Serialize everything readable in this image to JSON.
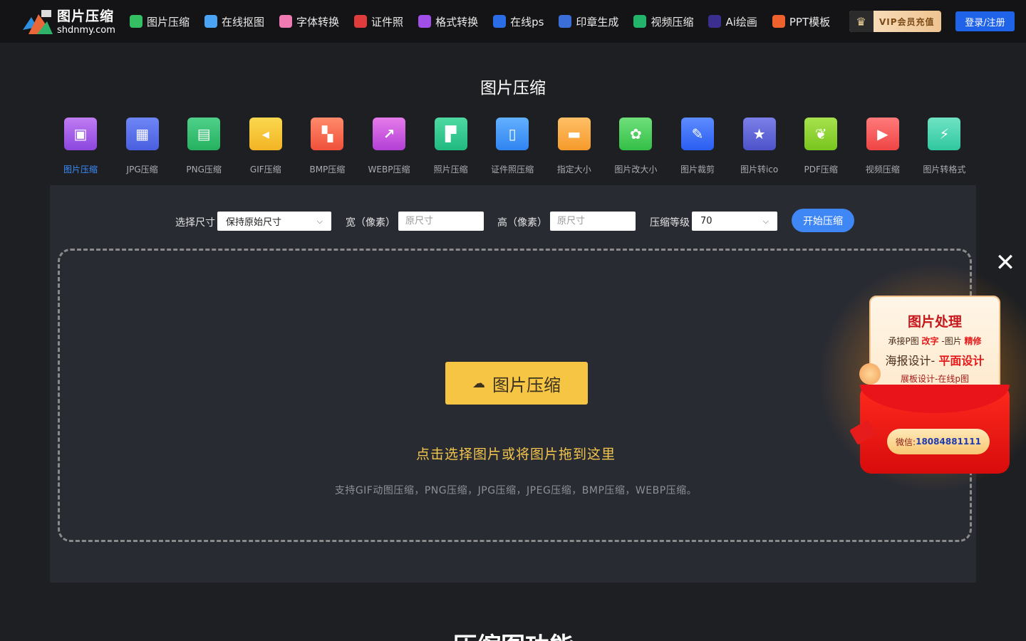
{
  "header": {
    "logo_title": "图片压缩",
    "logo_url": "shdnmy.com",
    "nav": [
      {
        "label": "图片压缩",
        "icon": "image-icon",
        "color": "#34c062"
      },
      {
        "label": "在线抠图",
        "icon": "cutout-icon",
        "color": "#4aa3f5"
      },
      {
        "label": "字体转换",
        "icon": "font-icon",
        "color": "#f07ab2"
      },
      {
        "label": "证件照",
        "icon": "id-photo-icon",
        "color": "#e03c3c"
      },
      {
        "label": "格式转换",
        "icon": "format-icon",
        "color": "#a24ee8"
      },
      {
        "label": "在线ps",
        "icon": "ps-icon",
        "color": "#2b6de6"
      },
      {
        "label": "印章生成",
        "icon": "stamp-icon",
        "color": "#3b6ed8"
      },
      {
        "label": "视频压缩",
        "icon": "video-icon",
        "color": "#21b46a"
      },
      {
        "label": "Ai绘画",
        "icon": "ai-icon",
        "color": "#3a2f8f"
      },
      {
        "label": "PPT模板",
        "icon": "ppt-icon",
        "color": "#f0622d"
      }
    ],
    "vip_label": "VIP会员充值",
    "login_label": "登录/注册"
  },
  "page_title": "图片压缩",
  "tools": [
    {
      "label": "图片压缩",
      "icon": "image-compress-icon",
      "gradient": [
        "#c07cf2",
        "#8b46df"
      ],
      "glyph": "▣",
      "active": true
    },
    {
      "label": "JPG压缩",
      "icon": "jpg-compress-icon",
      "gradient": [
        "#6e86f5",
        "#4a5fe0"
      ],
      "glyph": "▦",
      "active": false
    },
    {
      "label": "PNG压缩",
      "icon": "png-compress-icon",
      "gradient": [
        "#4fd08a",
        "#25b15f"
      ],
      "glyph": "▤",
      "active": false
    },
    {
      "label": "GIF压缩",
      "icon": "gif-compress-icon",
      "gradient": [
        "#fbd84e",
        "#f2b424"
      ],
      "glyph": "◂",
      "active": false
    },
    {
      "label": "BMP压缩",
      "icon": "bmp-compress-icon",
      "gradient": [
        "#ff8a6b",
        "#f0503a"
      ],
      "glyph": "▚",
      "active": false
    },
    {
      "label": "WEBP压缩",
      "icon": "webp-compress-icon",
      "gradient": [
        "#e57bea",
        "#b33fd6"
      ],
      "glyph": "↗",
      "active": false
    },
    {
      "label": "照片压缩",
      "icon": "photo-compress-icon",
      "gradient": [
        "#4fd9a3",
        "#20b980"
      ],
      "glyph": "▛",
      "active": false
    },
    {
      "label": "证件照压缩",
      "icon": "id-photo-compress-icon",
      "gradient": [
        "#63b0ff",
        "#2f84f0"
      ],
      "glyph": "▯",
      "active": false
    },
    {
      "label": "指定大小",
      "icon": "fixed-size-icon",
      "gradient": [
        "#ffbf66",
        "#f59a2b"
      ],
      "glyph": "▬",
      "active": false
    },
    {
      "label": "图片改大小",
      "icon": "resize-icon",
      "gradient": [
        "#6fe07a",
        "#33bf47"
      ],
      "glyph": "✿",
      "active": false
    },
    {
      "label": "图片裁剪",
      "icon": "crop-icon",
      "gradient": [
        "#5d8bff",
        "#2a5ef0"
      ],
      "glyph": "✎",
      "active": false
    },
    {
      "label": "图片转ico",
      "icon": "to-ico-icon",
      "gradient": [
        "#7a7fe8",
        "#4d52c9"
      ],
      "glyph": "★",
      "active": false
    },
    {
      "label": "PDF压缩",
      "icon": "pdf-compress-icon",
      "gradient": [
        "#a6e24d",
        "#79c51f"
      ],
      "glyph": "❦",
      "active": false
    },
    {
      "label": "视频压缩",
      "icon": "video-compress-icon",
      "gradient": [
        "#ff7a7a",
        "#ef4444"
      ],
      "glyph": "▶",
      "active": false
    },
    {
      "label": "图片转格式",
      "icon": "convert-format-icon",
      "gradient": [
        "#6fe3c4",
        "#2fc79f"
      ],
      "glyph": "⚡",
      "active": false
    }
  ],
  "controls": {
    "size_label": "选择尺寸",
    "size_value": "保持原始尺寸",
    "width_label": "宽（像素）",
    "width_placeholder": "原尺寸",
    "height_label": "高（像素）",
    "height_placeholder": "原尺寸",
    "level_label": "压缩等级",
    "level_value": "70",
    "start_label": "开始压缩"
  },
  "dropzone": {
    "button_label": "图片压缩",
    "hint": "点击选择图片或将图片拖到这里",
    "support": "支持GIF动图压缩，PNG压缩，JPG压缩，JPEG压缩，BMP压缩，WEBP压缩。"
  },
  "bottom_heading": "压缩图功能",
  "promo": {
    "title": "图片处理",
    "line1_a": "承接P图 ",
    "line1_b": "改字",
    "line1_c": " -图片 ",
    "line1_d": "精修",
    "line2_a": "海报设计- ",
    "line2_b": "平面设计",
    "line3": "展板设计-在线p图",
    "wechat_label": "微信:",
    "wechat_number": "18084881111"
  }
}
